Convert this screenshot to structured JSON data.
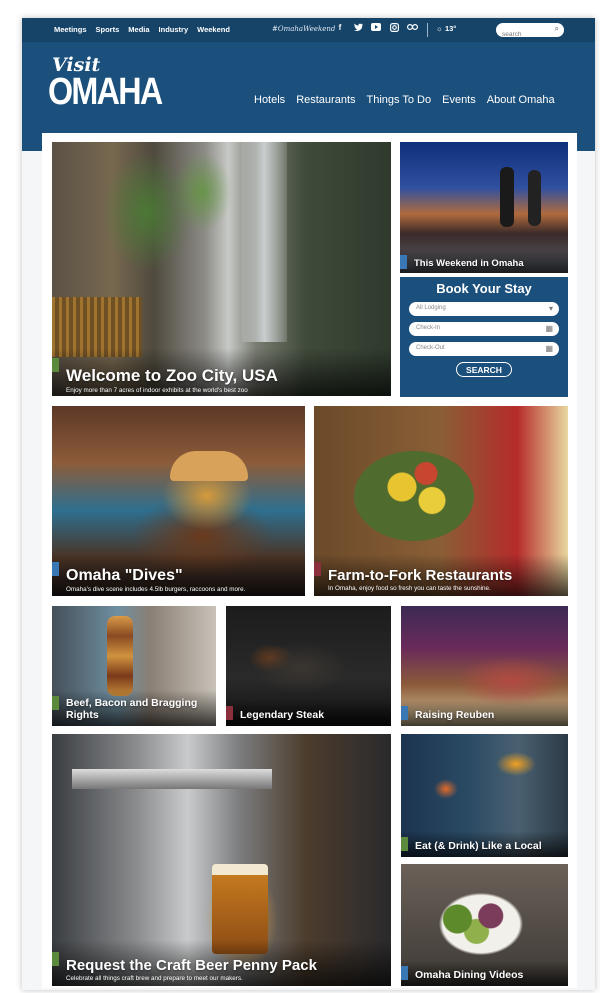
{
  "topbar": {
    "links": [
      "Meetings",
      "Sports",
      "Media",
      "Industry",
      "Weekend"
    ],
    "hashtag": "#OmahaWeekend",
    "social_icons": [
      "facebook-icon",
      "twitter-icon",
      "youtube-icon",
      "instagram-icon",
      "tripadvisor-icon"
    ],
    "weather": "☼ 13°",
    "search_placeholder": "search"
  },
  "logo": {
    "line1": "Visit",
    "line2": "OMAHA"
  },
  "nav": [
    "Hotels",
    "Restaurants",
    "Things To Do",
    "Events",
    "About Omaha"
  ],
  "booking": {
    "title": "Book Your Stay",
    "lodging": "All Lodging",
    "checkin": "Check-In",
    "checkout": "Check-Out",
    "button": "SEARCH"
  },
  "tiles": {
    "zoo": {
      "title": "Welcome to Zoo City, USA",
      "subtitle": "Enjoy more than 7 acres of indoor exhibits at the world's best zoo"
    },
    "weekend": {
      "title": "This Weekend in Omaha"
    },
    "dives": {
      "title": "Omaha \"Dives\"",
      "subtitle": "Omaha's dive scene includes 4.5lb burgers, raccoons and more."
    },
    "farm": {
      "title": "Farm-to-Fork Restaurants",
      "subtitle": "In Omaha, enjoy food so fresh you can taste the sunshine."
    },
    "bacon": {
      "title": "Beef, Bacon and Bragging Rights"
    },
    "steak": {
      "title": "Legendary Steak"
    },
    "reuben": {
      "title": "Raising Reuben"
    },
    "beer": {
      "title": "Request the Craft Beer Penny Pack",
      "subtitle": "Celebrate all things craft brew and prepare to meet our makers."
    },
    "drink": {
      "title": "Eat (& Drink) Like a Local"
    },
    "videos": {
      "title": "Omaha Dining Videos"
    }
  },
  "colors": {
    "header": "#1b4f7c",
    "green_flag": "#5b8a3c",
    "blue_flag": "#3a78b5",
    "red_flag": "#8b2f3c"
  }
}
